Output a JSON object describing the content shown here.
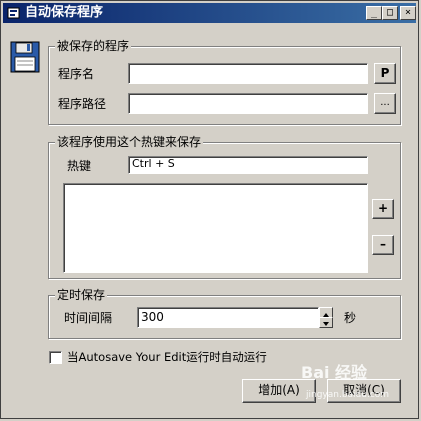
{
  "window": {
    "title": "自动保存程序",
    "controls": [
      "_",
      "□",
      "×"
    ]
  },
  "group_program": {
    "legend": "被保存的程序",
    "name_label": "程序名",
    "name_value": "",
    "name_button": "P",
    "path_label": "程序路径",
    "path_value": "",
    "path_button": "..."
  },
  "group_hotkey": {
    "legend": "该程序使用这个热键来保存",
    "hotkey_label": "热键",
    "hotkey_value": "Ctrl + S",
    "add_button": "+",
    "remove_button": "–"
  },
  "group_timer": {
    "legend": "定时保存",
    "interval_label": "时间间隔",
    "interval_value": "300",
    "unit": "秒"
  },
  "autorun": {
    "label": "当Autosave Your Edit运行时自动运行",
    "checked": false
  },
  "buttons": {
    "add": "增加(A)",
    "cancel": "取消(C)"
  },
  "watermark": {
    "text": "Bai 经验",
    "sub": "jingyan.baidu.com"
  }
}
